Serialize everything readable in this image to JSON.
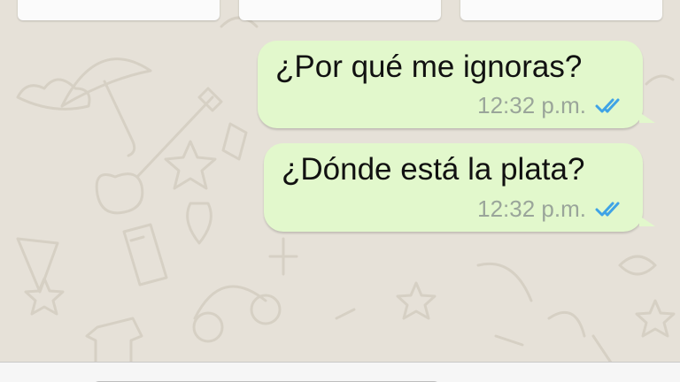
{
  "colors": {
    "chat_background": "#e6e1d8",
    "outgoing_bubble": "#e2f8cc",
    "timestamp_text": "#9aa59a",
    "read_ticks": "#3fa3e6"
  },
  "top_buttons": [
    {
      "label": ""
    },
    {
      "label": ""
    },
    {
      "label": ""
    }
  ],
  "messages": [
    {
      "text": "¿Por qué me ignoras?",
      "time": "12:32 p.m.",
      "status_icon": "double-check-icon",
      "direction": "outgoing"
    },
    {
      "text": "¿Dónde está la plata?",
      "time": "12:32 p.m.",
      "status_icon": "double-check-icon",
      "direction": "outgoing"
    }
  ],
  "input": {
    "placeholder": ""
  }
}
